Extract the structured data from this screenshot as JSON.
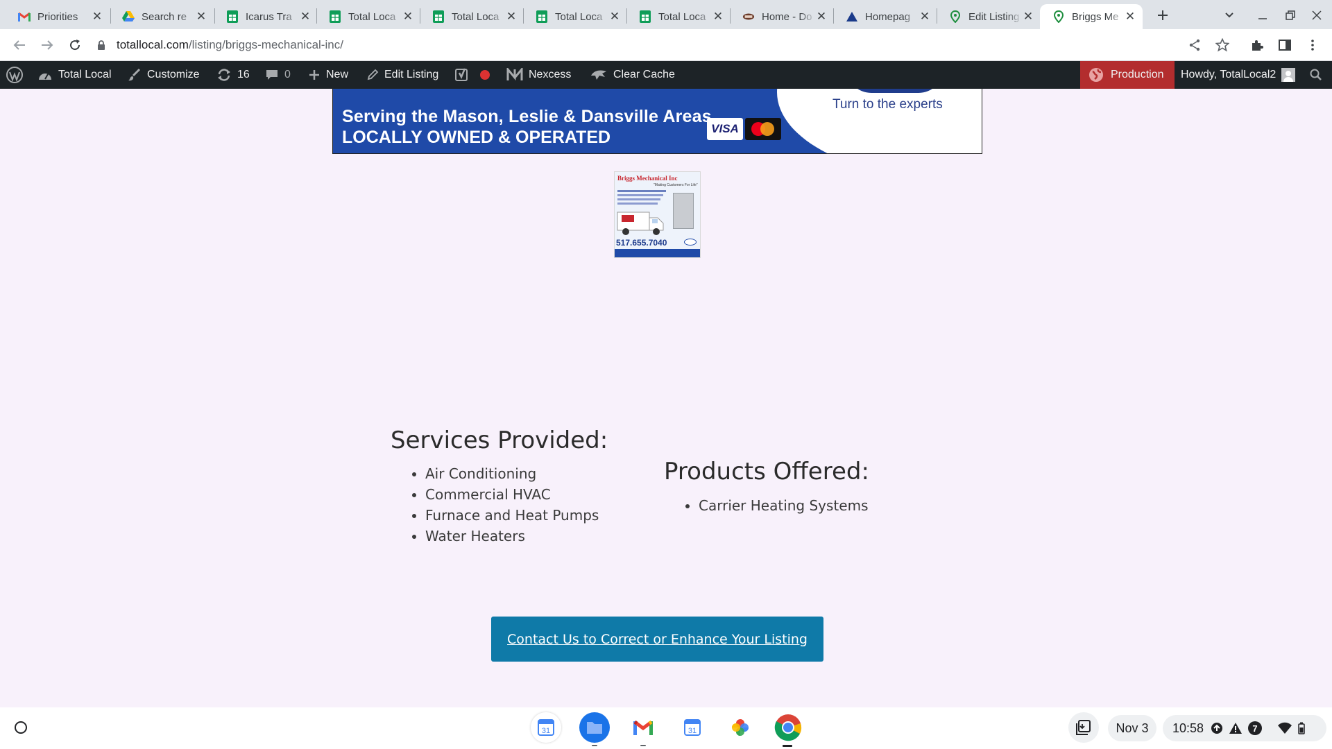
{
  "browser": {
    "tabs": [
      {
        "title": "Priorities",
        "icon": "gmail-icon"
      },
      {
        "title": "Search re",
        "icon": "drive-icon"
      },
      {
        "title": "Icarus Tra",
        "icon": "sheets-icon"
      },
      {
        "title": "Total Loca",
        "icon": "sheets-icon"
      },
      {
        "title": "Total Loca",
        "icon": "sheets-icon"
      },
      {
        "title": "Total Loca",
        "icon": "sheets-icon"
      },
      {
        "title": "Total Loca",
        "icon": "sheets-icon"
      },
      {
        "title": "Home - Do",
        "icon": "site-icon"
      },
      {
        "title": "Homepag",
        "icon": "triangle-icon"
      },
      {
        "title": "Edit Listing",
        "icon": "map-pin-icon"
      },
      {
        "title": "Briggs Me",
        "icon": "map-pin-icon",
        "active": true
      }
    ],
    "url_host": "totallocal.com",
    "url_path": "/listing/briggs-mechanical-inc/"
  },
  "adminbar": {
    "site_name": "Total Local",
    "customize": "Customize",
    "updates_count": "16",
    "comments_count": "0",
    "new_label": "New",
    "edit_listing": "Edit Listing",
    "nexcess": "Nexcess",
    "clear_cache": "Clear Cache",
    "environment": "Production",
    "howdy": "Howdy, TotalLocal2"
  },
  "banner": {
    "tagline1": "Serving the Mason, Leslie & Dansville Areas",
    "tagline2": "LOCALLY OWNED & OPERATED",
    "experts": "Turn to the experts",
    "visa": "VISA"
  },
  "thumbnail": {
    "company": "Briggs Mechanical Inc",
    "slogan": "\"Making Customers For Life\"",
    "phone": "517.655.7040"
  },
  "services": {
    "title": "Services Provided:",
    "items": [
      "Air Conditioning",
      "Commercial HVAC",
      "Furnace and Heat Pumps",
      "Water Heaters"
    ]
  },
  "products": {
    "title": "Products Offered:",
    "items": [
      "Carrier Heating Systems"
    ]
  },
  "cta": {
    "label": "Contact Us to Correct or Enhance Your Listing"
  },
  "shelf": {
    "date": "Nov 3",
    "time": "10:58",
    "notification_count": "7"
  },
  "colors": {
    "page_bg": "#f8f1fb",
    "adminbar_bg": "#1d2327",
    "production_red": "#b32d2e",
    "cta_blue": "#0f7aa8",
    "banner_blue": "#1f4aa8"
  }
}
